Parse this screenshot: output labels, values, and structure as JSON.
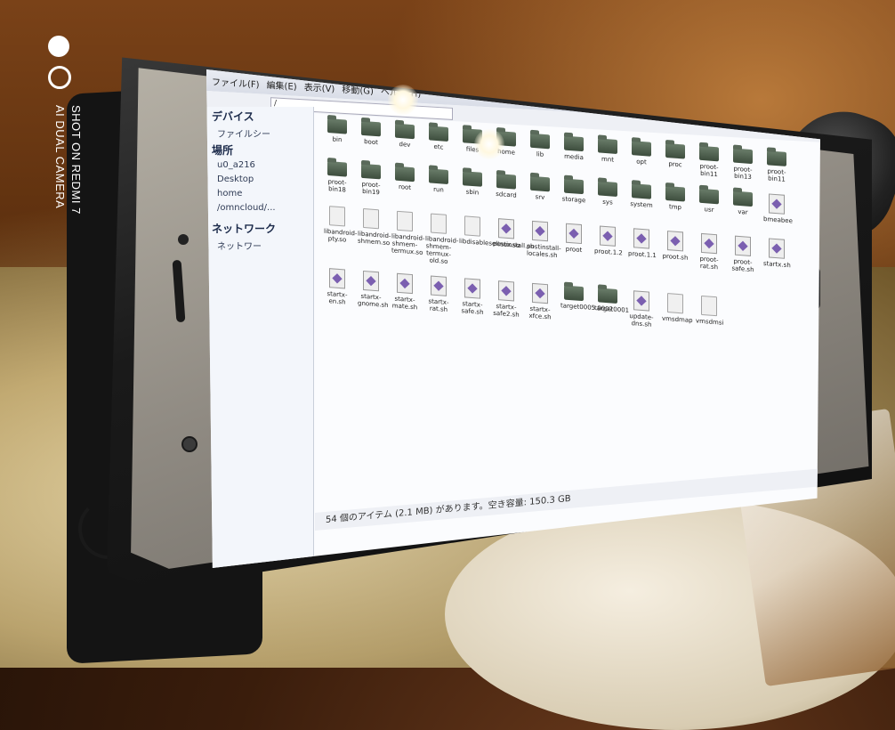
{
  "watermark": {
    "line1": "SHOT ON REDMI 7",
    "line2": "AI DUAL CAMERA"
  },
  "window": {
    "menu": [
      "ファイル(F)",
      "編集(E)",
      "表示(V)",
      "移動(G)",
      "ヘルプ(H)"
    ],
    "path": "/",
    "sidebar": {
      "devices_heading": "デバイス",
      "devices": [
        "ファイルシー"
      ],
      "places_heading": "場所",
      "places": [
        "u0_a216",
        "Desktop",
        "home",
        "/omncloud/..."
      ],
      "network_heading": "ネットワーク",
      "network": [
        "ネットワー"
      ]
    },
    "icons_row1": [
      "bin",
      "boot",
      "dev",
      "etc",
      "files",
      "home",
      "lib",
      "media",
      "mnt",
      "opt",
      "proc",
      "proot-bin11",
      "proot-bin13",
      "proot-bin11"
    ],
    "icons_row2": [
      "proot-bin18",
      "proot-bin19",
      "root",
      "run",
      "sbin",
      "sdcard",
      "srv",
      "storage",
      "sys",
      "system",
      "tmp",
      "usr",
      "var",
      "bmeabee"
    ],
    "icons_row3": [
      "libandroid-pty.so",
      "libandroid-shmem.so",
      "libandroid-shmem-termux.so",
      "libandroid-shmem-termux-old.so",
      "libdisableselinux.so",
      "postinstall.sh",
      "postinstall-locales.sh",
      "proot",
      "proot.1.2",
      "proot.1.1",
      "proot.sh",
      "proot-rat.sh",
      "proot-safe.sh",
      "startx.sh"
    ],
    "icons_row4": [
      "startx-en.sh",
      "startx-gnome.sh",
      "startx-mate.sh",
      "startx-rat.sh",
      "startx-safe.sh",
      "startx-safe2.sh",
      "startx-xfce.sh",
      "target0005.0002",
      "target0001",
      "update-dns.sh",
      "vmsdmap",
      "vmsdmsi"
    ],
    "status": "54 個のアイテム (2.1 MB) があります。空き容量: 150.3 GB"
  }
}
